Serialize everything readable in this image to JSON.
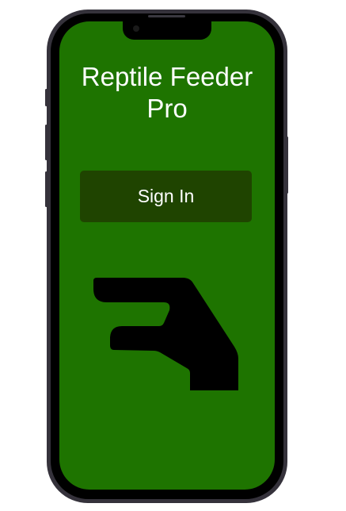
{
  "app": {
    "title": "Reptile Feeder Pro",
    "sign_in_label": "Sign In",
    "logo_icon": "hand-icon"
  },
  "colors": {
    "screen": "#1e7400",
    "button": "#1f4400",
    "frame": "#35323b"
  }
}
